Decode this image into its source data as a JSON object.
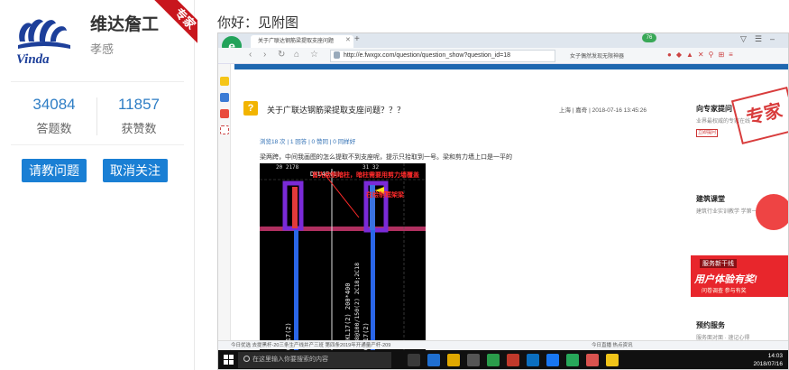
{
  "profile": {
    "name": "维达詹工",
    "title": "孝感",
    "badge": "专家",
    "stats": [
      {
        "value": "34084",
        "label": "答题数"
      },
      {
        "value": "11857",
        "label": "获赞数"
      }
    ],
    "ask_button": "请教问题",
    "unfollow_button": "取消关注"
  },
  "reply": {
    "greeting": "你好：见附图"
  },
  "browser": {
    "tab_title": "关于广联达钢筋梁提取支座问题",
    "tab_badge": "76",
    "url": "http://e.fwxgx.com/question/question_show?question_id=18",
    "search_hint": "女子偶然发现无限神器",
    "status_left": "今日优选    去提黑杆-20三条生产线并产三班   第四条2019年开通量产杆-209",
    "status_right": "今日直播   热点资讯"
  },
  "page": {
    "question_title": "关于广联达钢筋梁提取支座问题？？？",
    "question_meta": "上海 | 嘉奇 | 2018-07-16 13:45:26",
    "question_stats": "浏览18 次 | 1 回答 | 0 赞同 | 0 同样好",
    "question_body": "梁两跨，中间我画图的怎么提取不到支座呢，提示只拾取到一号。梁和剪力墙上口是一平的",
    "cad_note_1": "首先绘制暗柱，暗柱需要用剪力墙覆盖",
    "cad_note_2": "在绘制框架梁",
    "cad_labels": [
      "20 2178",
      "31 32",
      "DKL40(1)",
      "DKL17(2) 200*400",
      "A8@100/150(2) 2C18;2C18",
      "DKL17(2)",
      "DKL17(2)"
    ],
    "sidebar": [
      {
        "title": "向专家提问",
        "sub": "业界最权威的专家在线",
        "button": "立即提问"
      },
      {
        "title": "建筑课堂",
        "sub": "建筑行业实训教学 学第一平台"
      },
      {
        "title": "预约服务",
        "sub": "服务面对面 · 速记心得"
      }
    ],
    "stamp_text": "专家",
    "banner_top": "服务新干线",
    "banner_main": "用户体验有奖!",
    "banner_sub": "问卷调查 参与有奖"
  },
  "taskbar": {
    "search_placeholder": "在这里输入你要搜索的内容",
    "time": "14:03",
    "date": "2018/07/16"
  },
  "colors": {
    "accent_blue": "#1a7fd4",
    "site_blue": "#1e67b0",
    "stamp_red": "#d21b1b",
    "cad_bg": "#000000"
  }
}
